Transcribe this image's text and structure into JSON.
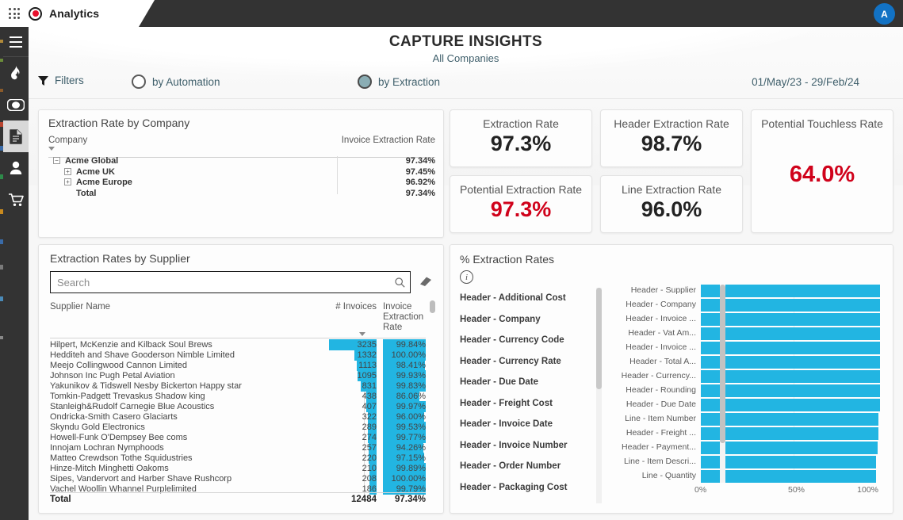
{
  "topbar": {
    "tab_label": "Analytics",
    "grid_icon": "app-grid-icon",
    "brand_icon": "record-dot-icon",
    "avatar_initial": "A"
  },
  "rail": {
    "items": [
      {
        "icon": "hamburger-menu-icon",
        "name": "menu"
      },
      {
        "icon": "flame-icon",
        "name": "flame",
        "glyph": "❦"
      },
      {
        "icon": "eye-icon",
        "name": "view",
        "glyph": "◉"
      },
      {
        "icon": "document-icon",
        "name": "documents",
        "glyph": "Ὄ4",
        "selected": true
      },
      {
        "icon": "person-icon",
        "name": "users",
        "glyph": "὆4"
      },
      {
        "icon": "cart-icon",
        "name": "orders",
        "glyph": "Ὥ2"
      }
    ]
  },
  "header": {
    "title": "CAPTURE INSIGHTS",
    "subtitle": "All Companies"
  },
  "filters": {
    "funnel_icon": "funnel-icon",
    "label": "Filters",
    "options": [
      {
        "label": "by Automation",
        "selected": false
      },
      {
        "label": "by Extraction",
        "selected": true
      }
    ],
    "date_range": "01/May/23 - 29/Feb/24",
    "accent_selected": "#8aadb4"
  },
  "company_card": {
    "title": "Extraction Rate by Company",
    "columns": [
      "Company",
      "Invoice Extraction Rate"
    ],
    "rows": [
      {
        "name": "Acme Global",
        "value": "97.34%",
        "indent": 0,
        "expander": "−"
      },
      {
        "name": "Acme UK",
        "value": "97.45%",
        "indent": 1,
        "expander": "+"
      },
      {
        "name": "Acme Europe",
        "value": "96.92%",
        "indent": 1,
        "expander": "+"
      },
      {
        "name": "Total",
        "value": "97.34%",
        "indent": 1,
        "expander": ""
      }
    ]
  },
  "kpis": [
    {
      "id": "extraction-rate",
      "label": "Extraction Rate",
      "value": "97.3%",
      "red": false
    },
    {
      "id": "header-extraction-rate",
      "label": "Header Extraction Rate",
      "value": "98.7%",
      "red": false
    },
    {
      "id": "potential-extraction-rate",
      "label": "Potential Extraction Rate",
      "value": "97.3%",
      "red": true
    },
    {
      "id": "line-extraction-rate",
      "label": "Line Extraction Rate",
      "value": "96.0%",
      "red": false
    },
    {
      "id": "potential-touchless-rate",
      "label": "Potential Touchless Rate",
      "value": "64.0%",
      "red": true
    }
  ],
  "supplier_card": {
    "title": "Extraction Rates by Supplier",
    "search_placeholder": "Search",
    "search_value": "",
    "search_icon": "search-icon",
    "eraser_icon": "eraser-icon",
    "columns": [
      "Supplier Name",
      "# Invoices",
      "Invoice Extraction Rate"
    ],
    "bar_color": "#22b5e2",
    "rows": [
      {
        "name": "Hilpert, McKenzie and Kilback Soul Brews",
        "invoices": "3235",
        "invoices_num": 3235,
        "rate": "99.84%",
        "rate_num": 99.84
      },
      {
        "name": "Hedditeh and Shave Gooderson Nimble Limited",
        "invoices": "1332",
        "invoices_num": 1332,
        "rate": "100.00%",
        "rate_num": 100.0
      },
      {
        "name": "Meejo Collingwood Cannon Limited",
        "invoices": "1113",
        "invoices_num": 1113,
        "rate": "98.41%",
        "rate_num": 98.41
      },
      {
        "name": "Johnson Inc Pugh Petal Aviation",
        "invoices": "1095",
        "invoices_num": 1095,
        "rate": "99.93%",
        "rate_num": 99.93
      },
      {
        "name": "Yakunikov & Tidswell Nesby Bickerton Happy star",
        "invoices": "831",
        "invoices_num": 831,
        "rate": "99.83%",
        "rate_num": 99.83
      },
      {
        "name": "Tomkin-Padgett Trevaskus Shadow king",
        "invoices": "438",
        "invoices_num": 438,
        "rate": "86.06%",
        "rate_num": 86.06
      },
      {
        "name": "Stanleigh&Rudolf Carnegie Blue Acoustics",
        "invoices": "407",
        "invoices_num": 407,
        "rate": "99.97%",
        "rate_num": 99.97
      },
      {
        "name": "Ondricka-Smith Casero Glaciarts",
        "invoices": "322",
        "invoices_num": 322,
        "rate": "96.00%",
        "rate_num": 96.0
      },
      {
        "name": "Skyndu Gold Electronics",
        "invoices": "289",
        "invoices_num": 289,
        "rate": "99.53%",
        "rate_num": 99.53
      },
      {
        "name": "Howell-Funk O'Dempsey Bee coms",
        "invoices": "274",
        "invoices_num": 274,
        "rate": "99.77%",
        "rate_num": 99.77
      },
      {
        "name": "Innojam Lochran Nymphoods",
        "invoices": "257",
        "invoices_num": 257,
        "rate": "94.26%",
        "rate_num": 94.26
      },
      {
        "name": "Matteo Crewdson Tothe Squidustries",
        "invoices": "220",
        "invoices_num": 220,
        "rate": "97.15%",
        "rate_num": 97.15
      },
      {
        "name": "Hinze-Mitch Minghetti Oakoms",
        "invoices": "210",
        "invoices_num": 210,
        "rate": "99.89%",
        "rate_num": 99.89
      },
      {
        "name": "Sipes, Vandervort and Harber Shave Rushcorp",
        "invoices": "208",
        "invoices_num": 208,
        "rate": "100.00%",
        "rate_num": 100.0
      },
      {
        "name": "Vachel Woollin Whannel Purplelimited",
        "invoices": "186",
        "invoices_num": 186,
        "rate": "99.79%",
        "rate_num": 99.79
      }
    ],
    "total": {
      "label": "Total",
      "invoices": "12484",
      "rate": "97.34%"
    }
  },
  "rates_card": {
    "title": "% Extraction Rates",
    "info_icon": "info-icon",
    "slicer_items": [
      "Header - Additional Cost",
      "Header - Company",
      "Header - Currency Code",
      "Header - Currency Rate",
      "Header - Due Date",
      "Header - Freight Cost",
      "Header - Invoice Date",
      "Header - Invoice Number",
      "Header - Order Number",
      "Header - Packaging Cost"
    ]
  },
  "chart_data": {
    "type": "bar",
    "orientation": "horizontal",
    "title": "% Extraction Rates",
    "xlabel": "",
    "ylabel": "",
    "xlim": [
      0,
      100
    ],
    "xticks": [
      "0%",
      "50%",
      "100%"
    ],
    "grid": true,
    "legend": false,
    "bar_color": "#22b5e2",
    "categories": [
      "Header - Supplier",
      "Header - Company",
      "Header - Invoice ...",
      "Header - Vat Am...",
      "Header - Invoice ...",
      "Header - Total A...",
      "Header - Currency...",
      "Header - Rounding",
      "Header - Due Date",
      "Line - Item Number",
      "Header - Freight ...",
      "Header - Payment...",
      "Line - Item Descri...",
      "Line - Quantity"
    ],
    "values": [
      100,
      100,
      100,
      100,
      100,
      100,
      99.9,
      99.9,
      99.8,
      99.2,
      99.1,
      98.5,
      97.9,
      97.7
    ]
  }
}
